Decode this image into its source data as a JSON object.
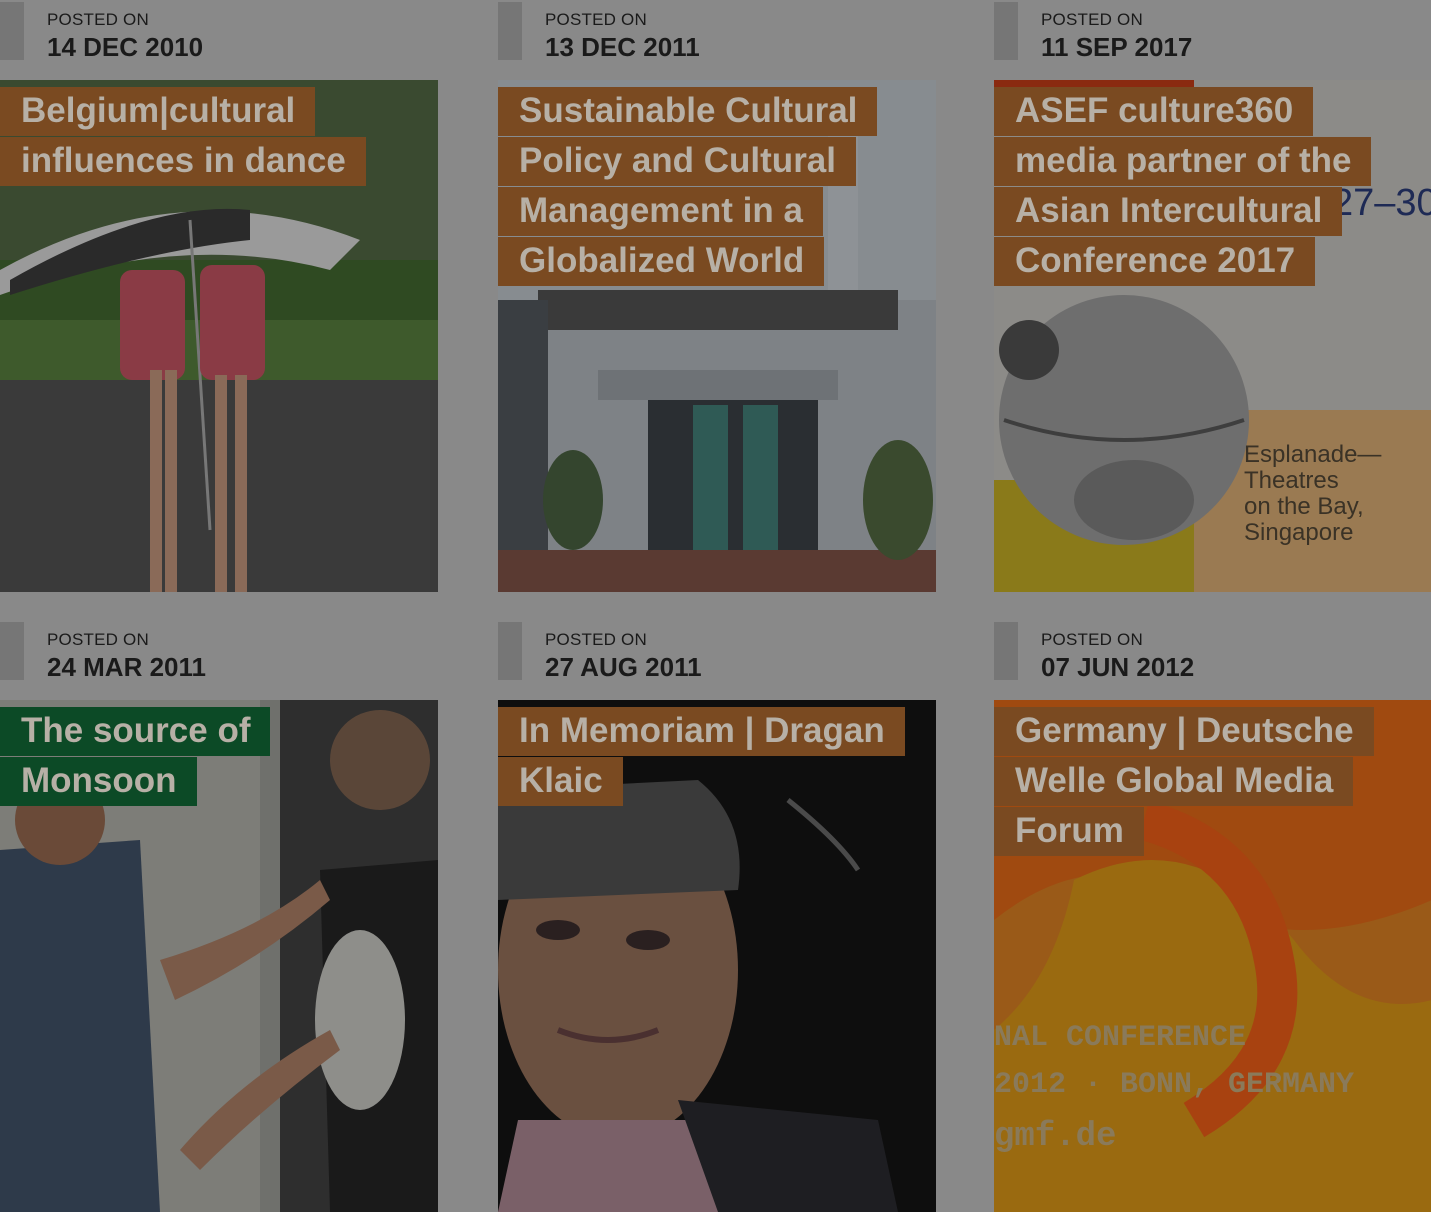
{
  "posts": [
    {
      "posted_label": "POSTED ON",
      "date": "14 DEC 2010",
      "title": "Belgium|cultural influences in dance",
      "title_color": "#7a4a21",
      "image": "girls-under-umbrella-in-rain"
    },
    {
      "posted_label": "POSTED ON",
      "date": "13 DEC 2011",
      "title": "Sustainable Cultural Policy and Cultural Management in a Globalized World",
      "title_color": "#7a4a21",
      "image": "white-building-entrance"
    },
    {
      "posted_label": "POSTED ON",
      "date": "11 SEP 2017",
      "title": "ASEF culture360 media partner of the Asian Intercultural Conference 2017",
      "title_color": "#7a4a21",
      "image": "conference-poster-globe",
      "image_text": {
        "dates": "27–30",
        "venue_line1": "Esplanade—",
        "venue_line2": "Theatres",
        "venue_line3": "on the Bay,",
        "venue_line4": "Singapore"
      }
    },
    {
      "posted_label": "POSTED ON",
      "date": "24 MAR 2011",
      "title": "The source of Monsoon",
      "title_color": "#0c4a26",
      "image": "dancers-rehearsing"
    },
    {
      "posted_label": "POSTED ON",
      "date": "27 AUG 2011",
      "title": "In Memoriam | Dragan Klaic",
      "title_color": "#7a4a21",
      "image": "man-portrait-dark"
    },
    {
      "posted_label": "POSTED ON",
      "date": "07 JUN 2012",
      "title": "Germany | Deutsche Welle Global Media Forum",
      "title_color": "#7a4a21",
      "image": "media-forum-orange-poster",
      "image_text": {
        "line1": "NAL CONFERENCE",
        "line2": "2012 · BONN, GERMANY",
        "line3": "gmf.de"
      }
    }
  ]
}
